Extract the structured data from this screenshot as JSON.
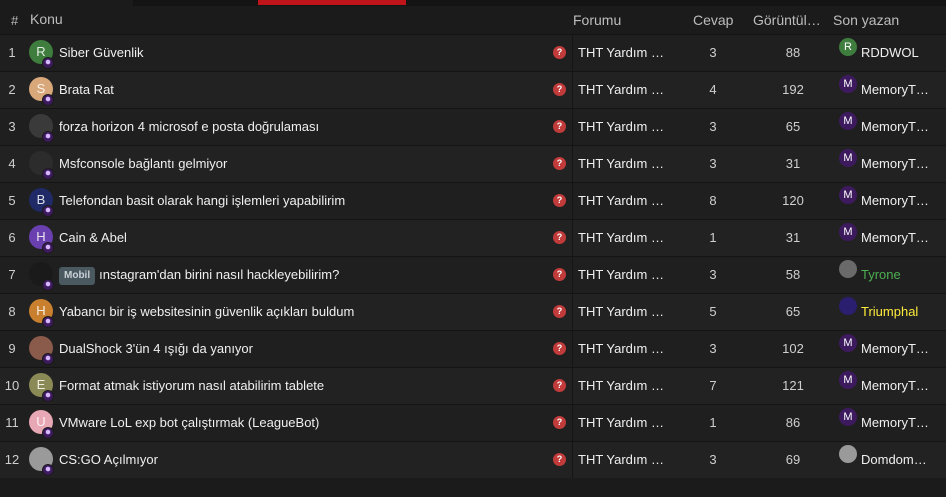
{
  "header": {
    "num": "#",
    "konu": "Konu",
    "forum": "Forumu",
    "cevap": "Cevap",
    "views": "Görüntüle…",
    "last": "Son yazan"
  },
  "rows": [
    {
      "num": "1",
      "initial": "R",
      "avatar_color": "#3e7d3e",
      "title": "Siber Güvenlik",
      "mobil": "",
      "forum": "THT Yardım …",
      "cevap": "3",
      "views": "88",
      "last_initial": "R",
      "last_avatar_color": "#3e7d3e",
      "last": "RDDWOL",
      "last_color": "#f0f0f0"
    },
    {
      "num": "2",
      "initial": "S",
      "avatar_color": "#d9a87a",
      "title": "Brata Rat",
      "mobil": "",
      "forum": "THT Yardım …",
      "cevap": "4",
      "views": "192",
      "last_initial": "M",
      "last_avatar_color": "#3d1a5e",
      "last": "MemoryT…",
      "last_color": "#f0f0f0"
    },
    {
      "num": "3",
      "initial": "",
      "avatar_color": "#3a3a3a",
      "title": "forza horizon 4 microsof e posta doğrulaması",
      "mobil": "",
      "forum": "THT Yardım …",
      "cevap": "3",
      "views": "65",
      "last_initial": "M",
      "last_avatar_color": "#3d1a5e",
      "last": "MemoryT…",
      "last_color": "#f0f0f0"
    },
    {
      "num": "4",
      "initial": "",
      "avatar_color": "#2c2c2c",
      "title": "Msfconsole bağlantı gelmiyor",
      "mobil": "",
      "forum": "THT Yardım …",
      "cevap": "3",
      "views": "31",
      "last_initial": "M",
      "last_avatar_color": "#3d1a5e",
      "last": "MemoryT…",
      "last_color": "#f0f0f0"
    },
    {
      "num": "5",
      "initial": "B",
      "avatar_color": "#1f2a66",
      "title": "Telefondan basit olarak hangi işlemleri yapabilirim",
      "mobil": "",
      "forum": "THT Yardım …",
      "cevap": "8",
      "views": "120",
      "last_initial": "M",
      "last_avatar_color": "#3d1a5e",
      "last": "MemoryT…",
      "last_color": "#f0f0f0"
    },
    {
      "num": "6",
      "initial": "H",
      "avatar_color": "#6a3fb0",
      "title": "Cain & Abel",
      "mobil": "",
      "forum": "THT Yardım …",
      "cevap": "1",
      "views": "31",
      "last_initial": "M",
      "last_avatar_color": "#3d1a5e",
      "last": "MemoryT…",
      "last_color": "#f0f0f0"
    },
    {
      "num": "7",
      "initial": "",
      "avatar_color": "#1a1a1a",
      "title": "ınstagram'dan birini nasıl hackleyebilirim?",
      "mobil": "Mobil",
      "forum": "THT Yardım …",
      "cevap": "3",
      "views": "58",
      "last_initial": "",
      "last_avatar_color": "#6a6a6a",
      "last": "Tyrone",
      "last_color": "#4caf50"
    },
    {
      "num": "8",
      "initial": "H",
      "avatar_color": "#c9802e",
      "title": "Yabancı bir iş websitesinin güvenlik açıkları buldum",
      "mobil": "",
      "forum": "THT Yardım …",
      "cevap": "5",
      "views": "65",
      "last_initial": "",
      "last_avatar_color": "#2a1f6e",
      "last": "Triumphal",
      "last_color": "#ffeb3b"
    },
    {
      "num": "9",
      "initial": "",
      "avatar_color": "#8a5a4a",
      "title": "DualShock 3'ün 4 ışığı da yanıyor",
      "mobil": "",
      "forum": "THT Yardım …",
      "cevap": "3",
      "views": "102",
      "last_initial": "M",
      "last_avatar_color": "#3d1a5e",
      "last": "MemoryT…",
      "last_color": "#f0f0f0"
    },
    {
      "num": "10",
      "initial": "E",
      "avatar_color": "#8a8a56",
      "title": "Format atmak istiyorum nasıl atabilirim tablete",
      "mobil": "",
      "forum": "THT Yardım …",
      "cevap": "7",
      "views": "121",
      "last_initial": "M",
      "last_avatar_color": "#3d1a5e",
      "last": "MemoryT…",
      "last_color": "#f0f0f0"
    },
    {
      "num": "11",
      "initial": "U",
      "avatar_color": "#e8a7b4",
      "title": "VMware LoL exp bot çalıştırmak (LeagueBot)",
      "mobil": "",
      "forum": "THT Yardım …",
      "cevap": "1",
      "views": "86",
      "last_initial": "M",
      "last_avatar_color": "#3d1a5e",
      "last": "MemoryT…",
      "last_color": "#f0f0f0"
    },
    {
      "num": "12",
      "initial": "",
      "avatar_color": "#9a9a9a",
      "title": "CS:GO Açılmıyor",
      "mobil": "",
      "forum": "THT Yardım …",
      "cevap": "3",
      "views": "69",
      "last_initial": "",
      "last_avatar_color": "#9a9a9a",
      "last": "Domdom…",
      "last_color": "#f0f0f0"
    }
  ],
  "colors": {
    "accent": "#c0141b",
    "question_icon": "#c23b3b"
  }
}
